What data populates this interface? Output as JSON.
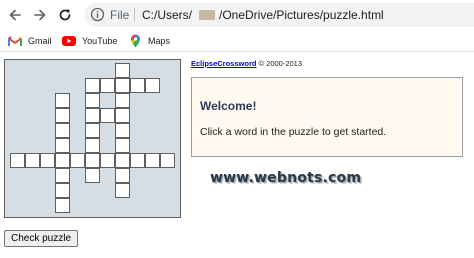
{
  "browser": {
    "scheme_label": "File",
    "url_prefix": "C:/Users/",
    "url_suffix": "/OneDrive/Pictures/puzzle.html",
    "icons": {
      "back": "arrow-left-icon",
      "forward": "arrow-right-icon",
      "reload": "reload-icon",
      "site_info": "info-icon"
    }
  },
  "bookmarks": [
    {
      "label": "Gmail",
      "icon": "gmail-icon"
    },
    {
      "label": "YouTube",
      "icon": "youtube-icon"
    },
    {
      "label": "Maps",
      "icon": "maps-icon"
    }
  ],
  "credit": {
    "link_text": "EclipseCrossword",
    "suffix": " © 2000-2013"
  },
  "welcome": {
    "title": "Welcome!",
    "message": "Click a word in the puzzle to get started."
  },
  "watermark": "www.webnots.com",
  "check_button": "Check puzzle",
  "colors": {
    "grid_background": "#d6dee5",
    "welcome_background": "#fff9ef",
    "welcome_title": "#2e3b58",
    "link": "#0000ee"
  }
}
